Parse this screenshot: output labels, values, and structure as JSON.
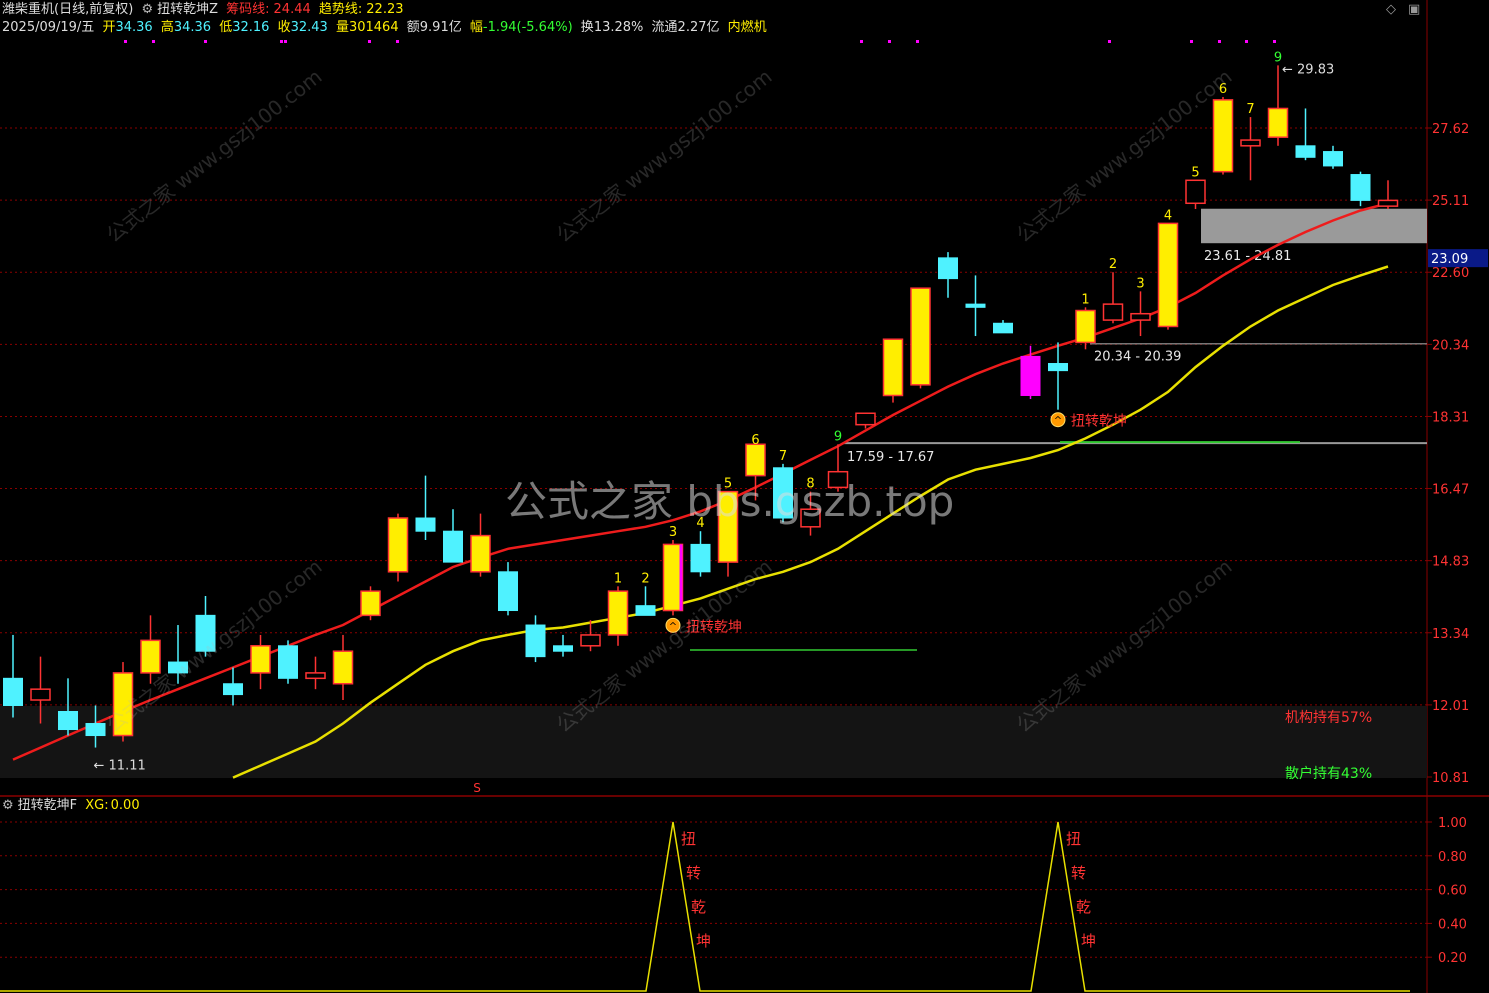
{
  "header": {
    "stock_name": "潍柴重机",
    "period": "(日线,前复权)",
    "indicator_name": "扭转乾坤Z",
    "chip_line_label": "筹码线:",
    "chip_line_value": "24.44",
    "trend_line_label": "趋势线:",
    "trend_line_value": "22.23",
    "date": "2025/09/19/五",
    "open_label": "开",
    "open_value": "34.36",
    "high_label": "高",
    "high_value": "34.36",
    "low_label": "低",
    "low_value": "32.16",
    "close_label": "收",
    "close_value": "32.43",
    "volume_label": "量",
    "volume_value": "301464",
    "amount_label": "额",
    "amount_value": "9.91亿",
    "change_label": "幅",
    "change_value": "-1.94(-5.64%)",
    "turnover_label": "换",
    "turnover_value": "13.28%",
    "float_label": "流通",
    "float_value": "2.27亿",
    "industry": "内燃机"
  },
  "sub_header": {
    "indicator_name": "扭转乾坤F",
    "xg_label": "XG:",
    "xg_value": "0.00"
  },
  "watermark": "公式之家 bbs.gszb.top",
  "stamp_text": "公式之家 www.gszj100.com",
  "colors": {
    "up": "#ffee00",
    "down": "#4ff2ff",
    "red_line": "#ee1c1c",
    "yellow_line": "#e8e000",
    "grid": "#8a0000",
    "magenta": "#ff00ff",
    "green": "#33cc33"
  },
  "chart_data": {
    "type": "candlestick",
    "y_axis_ticks": [
      "27.62",
      "25.11",
      "22.60",
      "20.34",
      "18.31",
      "16.47",
      "14.83",
      "13.34",
      "12.01",
      "10.81"
    ],
    "y_axis_values": [
      27.62,
      25.11,
      22.6,
      20.34,
      18.31,
      16.47,
      14.83,
      13.34,
      12.01,
      10.81
    ],
    "current_price_tag": "23.09",
    "candles": [
      {
        "o": 12.5,
        "h": 13.3,
        "l": 11.8,
        "c": 12.0
      },
      {
        "o": 12.1,
        "h": 12.9,
        "l": 11.7,
        "c": 12.3
      },
      {
        "o": 11.9,
        "h": 12.5,
        "l": 11.5,
        "c": 11.6
      },
      {
        "o": 11.7,
        "h": 12.0,
        "l": 11.3,
        "c": 11.5
      },
      {
        "o": 11.5,
        "h": 12.8,
        "l": 11.4,
        "c": 12.6
      },
      {
        "o": 12.6,
        "h": 13.7,
        "l": 12.4,
        "c": 13.2
      },
      {
        "o": 12.8,
        "h": 13.5,
        "l": 12.4,
        "c": 12.6
      },
      {
        "o": 13.7,
        "h": 14.1,
        "l": 12.9,
        "c": 13.0
      },
      {
        "o": 12.4,
        "h": 12.7,
        "l": 12.0,
        "c": 12.2
      },
      {
        "o": 12.6,
        "h": 13.3,
        "l": 12.3,
        "c": 13.1
      },
      {
        "o": 13.1,
        "h": 13.2,
        "l": 12.4,
        "c": 12.5
      },
      {
        "o": 12.5,
        "h": 12.9,
        "l": 12.3,
        "c": 12.6
      },
      {
        "o": 12.4,
        "h": 13.3,
        "l": 12.1,
        "c": 13.0
      },
      {
        "o": 13.7,
        "h": 14.3,
        "l": 13.6,
        "c": 14.2
      },
      {
        "o": 14.6,
        "h": 15.9,
        "l": 14.4,
        "c": 15.8
      },
      {
        "o": 15.8,
        "h": 16.8,
        "l": 15.3,
        "c": 15.5
      },
      {
        "o": 15.5,
        "h": 16.0,
        "l": 14.8,
        "c": 14.8
      },
      {
        "o": 14.6,
        "h": 15.9,
        "l": 14.5,
        "c": 15.4
      },
      {
        "o": 14.6,
        "h": 14.8,
        "l": 13.7,
        "c": 13.8
      },
      {
        "o": 13.5,
        "h": 13.7,
        "l": 12.8,
        "c": 12.9
      },
      {
        "o": 13.1,
        "h": 13.3,
        "l": 12.9,
        "c": 13.0
      },
      {
        "o": 13.1,
        "h": 13.6,
        "l": 13.0,
        "c": 13.3
      },
      {
        "o": 13.3,
        "h": 14.3,
        "l": 13.1,
        "c": 14.2
      },
      {
        "o": 13.9,
        "h": 14.3,
        "l": 13.7,
        "c": 13.7
      },
      {
        "o": 13.8,
        "h": 15.3,
        "l": 13.7,
        "c": 15.2
      },
      {
        "o": 15.2,
        "h": 15.5,
        "l": 14.5,
        "c": 14.6
      },
      {
        "o": 14.8,
        "h": 16.4,
        "l": 14.5,
        "c": 16.4
      },
      {
        "o": 16.8,
        "h": 17.5,
        "l": 16.2,
        "c": 17.6
      },
      {
        "o": 17.0,
        "h": 17.1,
        "l": 15.7,
        "c": 15.8
      },
      {
        "o": 15.6,
        "h": 16.4,
        "l": 15.4,
        "c": 16.0
      },
      {
        "o": 16.5,
        "h": 17.6,
        "l": 16.4,
        "c": 16.9
      },
      {
        "o": 18.1,
        "h": 18.4,
        "l": 18.0,
        "c": 18.4
      },
      {
        "o": 18.9,
        "h": 20.5,
        "l": 18.7,
        "c": 20.5
      },
      {
        "o": 19.2,
        "h": 22.1,
        "l": 19.1,
        "c": 22.1
      },
      {
        "o": 23.1,
        "h": 23.3,
        "l": 21.8,
        "c": 22.4
      },
      {
        "o": 21.6,
        "h": 22.5,
        "l": 20.6,
        "c": 21.5
      },
      {
        "o": 21.0,
        "h": 21.1,
        "l": 20.7,
        "c": 20.7
      },
      {
        "o": 20.0,
        "h": 20.3,
        "l": 18.8,
        "c": 18.9
      },
      {
        "o": 19.8,
        "h": 20.4,
        "l": 18.5,
        "c": 19.6
      },
      {
        "o": 20.4,
        "h": 21.5,
        "l": 20.2,
        "c": 21.4
      },
      {
        "o": 21.1,
        "h": 22.6,
        "l": 21.0,
        "c": 21.6
      },
      {
        "o": 21.1,
        "h": 22.0,
        "l": 20.6,
        "c": 21.3
      },
      {
        "o": 20.9,
        "h": 24.3,
        "l": 20.8,
        "c": 24.3
      },
      {
        "o": 25.0,
        "h": 25.8,
        "l": 24.8,
        "c": 25.8
      },
      {
        "o": 26.1,
        "h": 28.7,
        "l": 26.0,
        "c": 28.6
      },
      {
        "o": 27.0,
        "h": 28.0,
        "l": 25.8,
        "c": 27.2
      },
      {
        "o": 27.3,
        "h": 29.8,
        "l": 27.0,
        "c": 28.3
      },
      {
        "o": 27.0,
        "h": 28.3,
        "l": 26.5,
        "c": 26.6
      },
      {
        "o": 26.8,
        "h": 27.0,
        "l": 26.2,
        "c": 26.3
      },
      {
        "o": 26.0,
        "h": 26.1,
        "l": 24.9,
        "c": 25.1
      },
      {
        "o": 24.9,
        "h": 25.8,
        "l": 24.8,
        "c": 25.1
      }
    ],
    "magenta_candles": [
      37
    ],
    "tomato_candle_index": 24,
    "red_ma": [
      11.1,
      11.3,
      11.5,
      11.7,
      11.9,
      12.1,
      12.3,
      12.5,
      12.7,
      12.9,
      13.1,
      13.3,
      13.5,
      13.8,
      14.1,
      14.4,
      14.7,
      14.9,
      15.1,
      15.2,
      15.3,
      15.4,
      15.5,
      15.6,
      15.75,
      15.95,
      16.2,
      16.5,
      16.85,
      17.2,
      17.55,
      17.95,
      18.35,
      18.75,
      19.15,
      19.5,
      19.8,
      20.05,
      20.3,
      20.55,
      20.85,
      21.15,
      21.5,
      21.95,
      22.5,
      23.05,
      23.55,
      24.0,
      24.4,
      24.75,
      25.0
    ],
    "yellow_ma": [
      null,
      null,
      null,
      null,
      null,
      null,
      null,
      null,
      10.8,
      11.0,
      11.2,
      11.4,
      11.7,
      12.05,
      12.4,
      12.75,
      13.0,
      13.2,
      13.3,
      13.4,
      13.45,
      13.55,
      13.65,
      13.75,
      13.9,
      14.05,
      14.25,
      14.45,
      14.6,
      14.8,
      15.1,
      15.5,
      15.9,
      16.3,
      16.7,
      16.95,
      17.1,
      17.25,
      17.45,
      17.75,
      18.1,
      18.5,
      19.0,
      19.7,
      20.3,
      20.9,
      21.4,
      21.8,
      22.2,
      22.5,
      22.8
    ],
    "count_labels": [
      {
        "i": 22,
        "t": "1",
        "c": "#ffee00"
      },
      {
        "i": 23,
        "t": "2",
        "c": "#ffee00"
      },
      {
        "i": 24,
        "t": "3",
        "c": "#ffee00"
      },
      {
        "i": 25,
        "t": "4",
        "c": "#ffee00"
      },
      {
        "i": 26,
        "t": "5",
        "c": "#ffee00"
      },
      {
        "i": 27,
        "t": "6",
        "c": "#ffee00"
      },
      {
        "i": 28,
        "t": "7",
        "c": "#ffee00"
      },
      {
        "i": 29,
        "t": "8",
        "c": "#ffee00"
      },
      {
        "i": 30,
        "t": "9",
        "c": "#33ff33"
      },
      {
        "i": 39,
        "t": "1",
        "c": "#ffee00"
      },
      {
        "i": 40,
        "t": "2",
        "c": "#ffee00"
      },
      {
        "i": 41,
        "t": "3",
        "c": "#ffee00"
      },
      {
        "i": 42,
        "t": "4",
        "c": "#ffee00"
      },
      {
        "i": 43,
        "t": "5",
        "c": "#ffee00"
      },
      {
        "i": 44,
        "t": "6",
        "c": "#ffee00"
      },
      {
        "i": 45,
        "t": "7",
        "c": "#ffee00"
      },
      {
        "i": 46,
        "t": "9",
        "c": "#33ff33"
      }
    ],
    "signals": [
      {
        "i": 24,
        "label": "扭转乾坤"
      },
      {
        "i": 38,
        "label": "扭转乾坤"
      }
    ],
    "zones": [
      {
        "label": "23.61 - 24.81",
        "lo": 23.61,
        "hi": 24.81
      },
      {
        "label": "20.34 - 20.39",
        "lo": 20.34,
        "hi": 20.39
      },
      {
        "label": "17.59 - 17.67",
        "lo": 17.59,
        "hi": 17.67
      }
    ],
    "high_mark": "29.83",
    "low_mark": "11.11",
    "s_mark": "S",
    "holdings": [
      {
        "label": "机构持有",
        "value": "57%",
        "color": "#ff3333"
      },
      {
        "label": "散户持有",
        "value": "43%",
        "color": "#33ff33"
      }
    ],
    "sub_ticks": [
      "1.00",
      "0.80",
      "0.60",
      "0.40",
      "0.20"
    ],
    "sub_values": [
      1.0,
      0.8,
      0.6,
      0.4,
      0.2
    ],
    "sub_spikes": [
      24,
      38
    ],
    "sub_spike_chars": [
      "扭",
      "转",
      "乾",
      "坤"
    ]
  }
}
